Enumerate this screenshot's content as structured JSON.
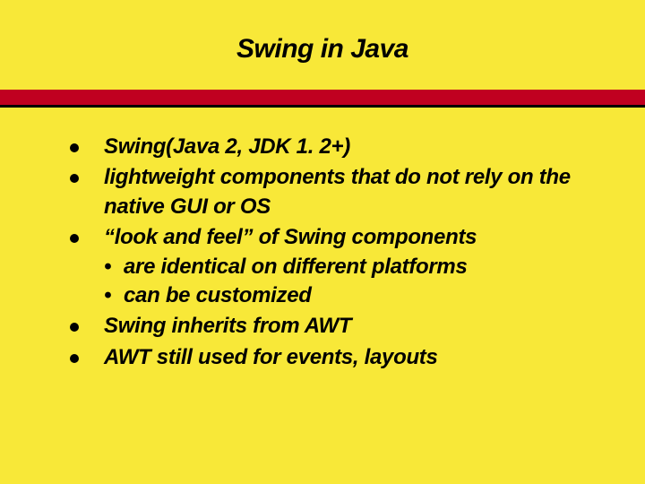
{
  "slide": {
    "title": "Swing in Java",
    "bullets": [
      {
        "text": "Swing(Java 2, JDK 1. 2+)",
        "subitems": []
      },
      {
        "text": "lightweight components that do not rely on the native GUI or OS",
        "subitems": []
      },
      {
        "text": "“look and feel” of Swing components",
        "subitems": [
          "are identical on different platforms",
          "can be customized"
        ]
      },
      {
        "text": "Swing inherits from AWT",
        "subitems": []
      },
      {
        "text": "AWT still used for events, layouts",
        "subitems": []
      }
    ]
  },
  "colors": {
    "background": "#f8e838",
    "divider": "#c00020"
  }
}
